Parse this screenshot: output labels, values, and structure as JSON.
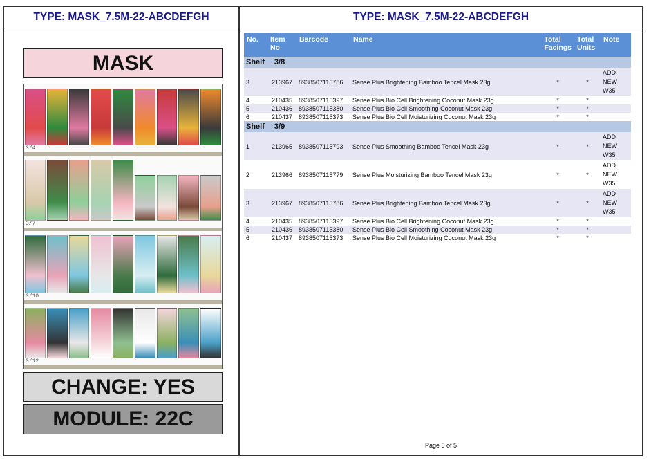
{
  "left_panel": {
    "title": "TYPE: MASK_7.5M-22-ABCDEFGH",
    "category": "MASK",
    "change": "CHANGE: YES",
    "module": "MODULE: 22C",
    "shelves": [
      {
        "label": "3/4"
      },
      {
        "label": "3/7"
      },
      {
        "label": "3/10"
      },
      {
        "label": "3/12"
      }
    ]
  },
  "right_panel": {
    "title": "TYPE: MASK_7.5M-22-ABCDEFGH",
    "columns": {
      "no": "No.",
      "item_no": "Item\nNo",
      "barcode": "Barcode",
      "name": "Name",
      "total_facings": "Total\nFacings",
      "total_units": "Total\nUnits",
      "note": "Note"
    },
    "shelf_word": "Shelf",
    "groups": [
      {
        "shelf": "3/8",
        "rows": [
          {
            "no": "3",
            "item": "213967",
            "barcode": "8938507115786",
            "name": "Sense Plus Brightening Bamboo Tencel Mask 23g",
            "facings": "*",
            "units": "*",
            "note": [
              "ADD",
              "NEW",
              "W35"
            ]
          },
          {
            "no": "4",
            "item": "210435",
            "barcode": "8938507115397",
            "name": "Sense Plus Bio Cell Brightening Coconut Mask 23g",
            "facings": "*",
            "units": "*",
            "note": []
          },
          {
            "no": "5",
            "item": "210436",
            "barcode": "8938507115380",
            "name": "Sense Plus Bio Cell Smoothing Coconut Mask 23g",
            "facings": "*",
            "units": "*",
            "note": []
          },
          {
            "no": "6",
            "item": "210437",
            "barcode": "8938507115373",
            "name": "Sense Plus Bio Cell Moisturizing Coconut Mask 23g",
            "facings": "*",
            "units": "*",
            "note": []
          }
        ]
      },
      {
        "shelf": "3/9",
        "rows": [
          {
            "no": "1",
            "item": "213965",
            "barcode": "8938507115793",
            "name": "Sense Plus Smoothing Bamboo Tencel Mask 23g",
            "facings": "*",
            "units": "*",
            "note": [
              "ADD",
              "NEW",
              "W35"
            ]
          },
          {
            "no": "2",
            "item": "213966",
            "barcode": "8938507115779",
            "name": "Sense Plus Moisturizing Bamboo Tencel Mask 23g",
            "facings": "*",
            "units": "*",
            "note": [
              "ADD",
              "NEW",
              "W35"
            ]
          },
          {
            "no": "3",
            "item": "213967",
            "barcode": "8938507115786",
            "name": "Sense Plus Brightening Bamboo Tencel Mask 23g",
            "facings": "*",
            "units": "*",
            "note": [
              "ADD",
              "NEW",
              "W35"
            ]
          },
          {
            "no": "4",
            "item": "210435",
            "barcode": "8938507115397",
            "name": "Sense Plus Bio Cell Brightening Coconut Mask 23g",
            "facings": "*",
            "units": "*",
            "note": []
          },
          {
            "no": "5",
            "item": "210436",
            "barcode": "8938507115380",
            "name": "Sense Plus Bio Cell Smoothing Coconut Mask 23g",
            "facings": "*",
            "units": "*",
            "note": []
          },
          {
            "no": "6",
            "item": "210437",
            "barcode": "8938507115373",
            "name": "Sense Plus Bio Cell Moisturizing Coconut Mask 23g",
            "facings": "*",
            "units": "*",
            "note": []
          }
        ]
      }
    ],
    "footer": "Page 5 of 5"
  },
  "colors": {
    "title_text": "#1a1a8c",
    "header_bg": "#5b8fd6",
    "shelf_row_bg": "#b7c8e4",
    "odd_row_bg": "#e6e6f4",
    "mask_box_bg": "#f6d4dc",
    "change_box_bg": "#d9d9d9",
    "module_box_bg": "#9a9a9a"
  }
}
